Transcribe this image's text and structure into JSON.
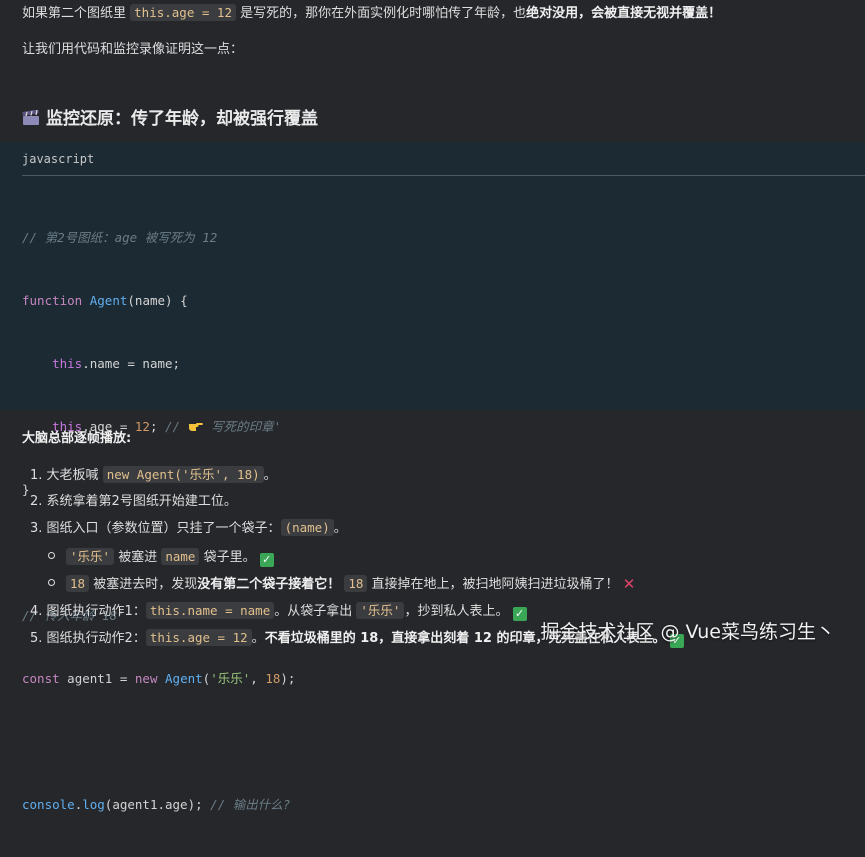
{
  "intro": {
    "part1": "如果第二个图纸里 ",
    "code": "this.age = 12",
    "part2": " 是写死的，那你在外面实例化时哪怕传了年龄，也",
    "bold": "绝对没用，会被直接无视并覆盖！"
  },
  "lead": "让我们用代码和监控录像证明这一点：",
  "section_title": "监控还原：传了年龄，却被强行覆盖",
  "code_block": {
    "language": "javascript",
    "lines": {
      "l1": "// 第2号图纸：age 被写死为 12",
      "l2_kw": "function",
      "l2_fn": "Agent",
      "l2_rest": "(name) {",
      "l3_this": "this",
      "l3_rest": ".name = name;",
      "l4_this": "this",
      "l4_mid": ".age = ",
      "l4_num": "12",
      "l4_semi": ";",
      "l4_comment_a": "//",
      "l4_comment_b": "写死的印章'",
      "l5": "}",
      "l7": "// 传入年龄 18'",
      "l8_kw": "const",
      "l8_a": " agent1 = ",
      "l8_new": "new",
      "l8_fn": "Agent",
      "l8_p": "(",
      "l8_str": "'乐乐'",
      "l8_c": ", ",
      "l8_num": "18",
      "l8_end": ");",
      "l10_obj": "console",
      "l10_dot": ".",
      "l10_fn": "log",
      "l10_rest": "(agent1.age);",
      "l10_comment": "// 输出什么?"
    }
  },
  "steps_title": "大脑总部逐帧播放:",
  "steps": {
    "s1_num": "1.",
    "s1_text": "大老板喊 ",
    "s1_code": "new Agent('乐乐', 18)",
    "s1_end": "。",
    "s2_num": "2.",
    "s2_text": "系统拿着第2号图纸开始建工位。",
    "s3_num": "3.",
    "s3_text": "图纸入口（参数位置）只挂了一个袋子：",
    "s3_code": "(name)",
    "s3_end": "。",
    "b1_code": "'乐乐'",
    "b1_text": " 被塞进 ",
    "b1_code2": "name",
    "b1_end": " 袋子里。",
    "b2_code": "18",
    "b2_text": " 被塞进去时，发现",
    "b2_bold": "没有第二个袋子接着它！",
    "b2_code2": "18",
    "b2_end": " 直接掉在地上，被扫地阿姨扫进垃圾桶了！",
    "s4_num": "4.",
    "s4_text": "图纸执行动作1：",
    "s4_code": "this.name = name",
    "s4_mid": "。从袋子拿出 ",
    "s4_code2": "'乐乐'",
    "s4_end": "，抄到私人表上。",
    "s5_num": "5.",
    "s5_text": "图纸执行动作2：",
    "s5_code": "this.age = 12",
    "s5_end": "。",
    "s5_bold": "不看垃圾桶里的 18，直接拿出刻着 12 的印章，死死盖在私人表上。"
  },
  "watermark": "掘金技术社区 @ Vue菜鸟练习生丶",
  "colors": {
    "background": "#25272b",
    "code_background": "#1c2a33",
    "check": "#3aa757",
    "cross": "#e0446a"
  }
}
